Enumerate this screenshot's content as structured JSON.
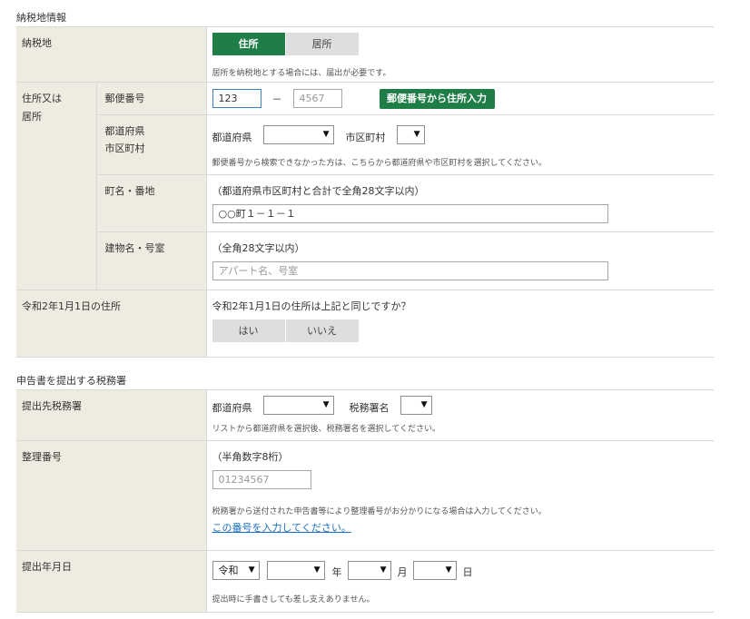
{
  "section1": {
    "title": "納税地情報",
    "row_nouzeichi": {
      "label": "納税地",
      "opt_address": "住所",
      "opt_residence": "居所",
      "note": "居所を納税地とする場合には、届出が必要です。"
    },
    "group_label_line1": "住所又は",
    "group_label_line2": "居所",
    "row_postal": {
      "label": "郵便番号",
      "part1_value": "123",
      "separator": "－",
      "part2_placeholder": "4567",
      "lookup_button": "郵便番号から住所入力"
    },
    "row_pref": {
      "label_line1": "都道府県",
      "label_line2": "市区町村",
      "pref_label": "都道府県",
      "city_label": "市区町村",
      "pref_value": "",
      "city_value": "",
      "note": "郵便番号から検索できなかった方は、こちらから都道府県や市区町村を選択してください。"
    },
    "row_town": {
      "label": "町名・番地",
      "note": "（都道府県市区町村と合計で全角28文字以内）",
      "value": "○○町１－１－１"
    },
    "row_building": {
      "label": "建物名・号室",
      "note": "（全角28文字以内）",
      "placeholder": "アパート名、号室"
    },
    "row_prev_address": {
      "label": "令和2年1月1日の住所",
      "question": "令和2年1月1日の住所は上記と同じですか？",
      "yes": "はい",
      "no": "いいえ"
    }
  },
  "section2": {
    "title": "申告書を提出する税務署",
    "row_office": {
      "label": "提出先税務署",
      "pref_label": "都道府県",
      "office_label": "税務署名",
      "pref_value": "",
      "office_value": "",
      "note": "リストから都道府県を選択後、税務署名を選択してください。"
    },
    "row_seiri": {
      "label": "整理番号",
      "note": "（半角数字8桁）",
      "placeholder": "01234567",
      "help": "税務署から送付された申告書等により整理番号がお分かりになる場合は入力してください。",
      "link": "この番号を入力してください。"
    },
    "row_date": {
      "label": "提出年月日",
      "era_value": "令和",
      "year_value": "",
      "year_unit": "年",
      "month_value": "",
      "month_unit": "月",
      "day_value": "",
      "day_unit": "日",
      "note": "提出時に手書きしても差し支えありません。"
    }
  },
  "icons": {
    "dropdown": "▼"
  },
  "colors": {
    "primary_green": "#1f7d47",
    "label_bg": "#eeebe0",
    "link_blue": "#1a6fc4"
  }
}
